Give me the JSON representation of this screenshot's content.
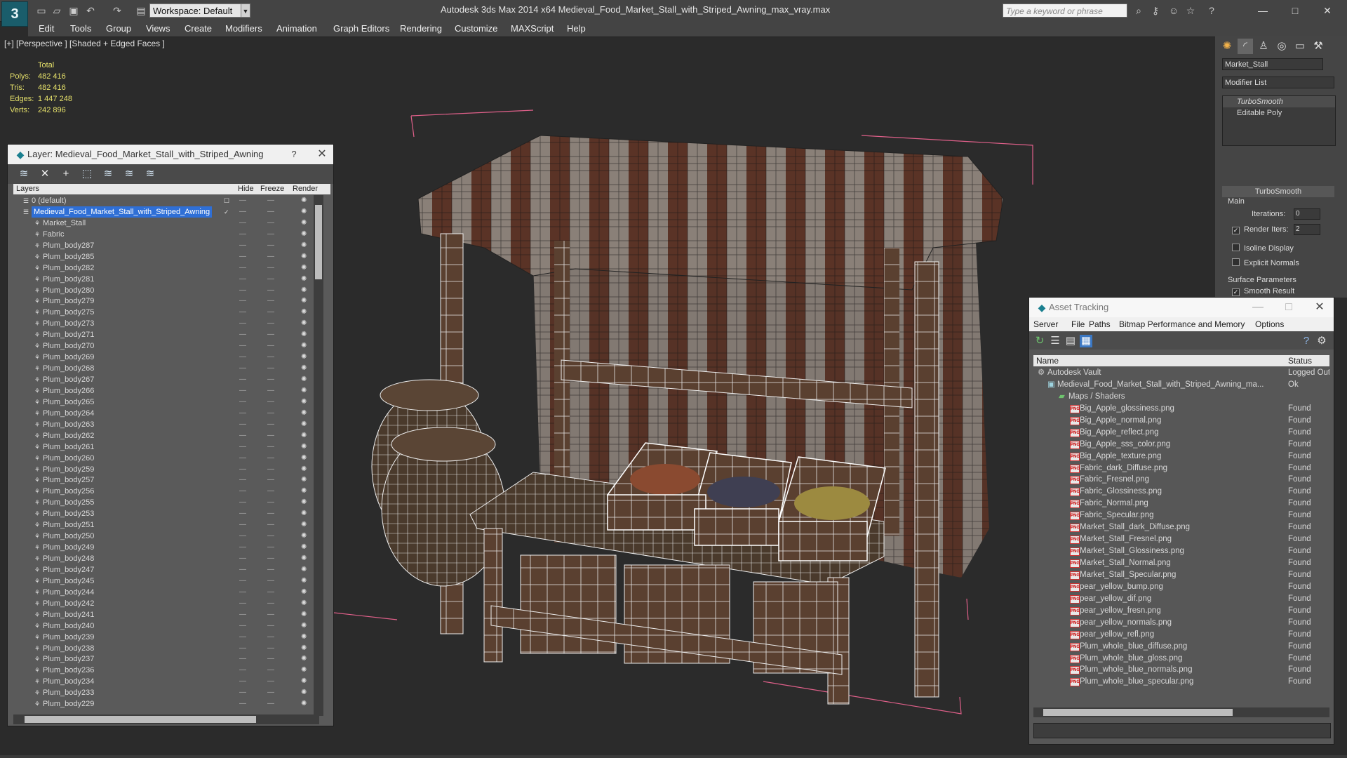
{
  "app": {
    "logo": "3",
    "workspace": "Workspace: Default",
    "title": "Autodesk 3ds Max  2014 x64       Medieval_Food_Market_Stall_with_Striped_Awning_max_vray.max",
    "search_placeholder": "Type a keyword or phrase"
  },
  "menu": [
    "Edit",
    "Tools",
    "Group",
    "Views",
    "Create",
    "Modifiers",
    "Animation",
    "Graph Editors",
    "Rendering",
    "Customize",
    "MAXScript",
    "Help"
  ],
  "viewport": {
    "label": "[+] [Perspective ] [Shaded + Edged Faces ]",
    "stats": {
      "header": "Total",
      "rows": [
        {
          "label": "Polys:",
          "value": "482 416"
        },
        {
          "label": "Tris:",
          "value": "482 416"
        },
        {
          "label": "Edges:",
          "value": "1 447 248"
        },
        {
          "label": "Verts:",
          "value": "242 896"
        }
      ]
    }
  },
  "layers": {
    "title": "Layer: Medieval_Food_Market_Stall_with_Striped_Awning",
    "help": "?",
    "columns": {
      "layers": "Layers",
      "hide": "Hide",
      "freeze": "Freeze",
      "render": "Render"
    },
    "rows": [
      {
        "name": "0 (default)",
        "level": 1
      },
      {
        "name": "Medieval_Food_Market_Stall_with_Striped_Awning",
        "level": 1,
        "selected": true
      },
      {
        "name": "Market_Stall",
        "level": 2
      },
      {
        "name": "Fabric",
        "level": 2
      },
      {
        "name": "Plum_body287",
        "level": 2
      },
      {
        "name": "Plum_body285",
        "level": 2
      },
      {
        "name": "Plum_body282",
        "level": 2
      },
      {
        "name": "Plum_body281",
        "level": 2
      },
      {
        "name": "Plum_body280",
        "level": 2
      },
      {
        "name": "Plum_body279",
        "level": 2
      },
      {
        "name": "Plum_body275",
        "level": 2
      },
      {
        "name": "Plum_body273",
        "level": 2
      },
      {
        "name": "Plum_body271",
        "level": 2
      },
      {
        "name": "Plum_body270",
        "level": 2
      },
      {
        "name": "Plum_body269",
        "level": 2
      },
      {
        "name": "Plum_body268",
        "level": 2
      },
      {
        "name": "Plum_body267",
        "level": 2
      },
      {
        "name": "Plum_body266",
        "level": 2
      },
      {
        "name": "Plum_body265",
        "level": 2
      },
      {
        "name": "Plum_body264",
        "level": 2
      },
      {
        "name": "Plum_body263",
        "level": 2
      },
      {
        "name": "Plum_body262",
        "level": 2
      },
      {
        "name": "Plum_body261",
        "level": 2
      },
      {
        "name": "Plum_body260",
        "level": 2
      },
      {
        "name": "Plum_body259",
        "level": 2
      },
      {
        "name": "Plum_body257",
        "level": 2
      },
      {
        "name": "Plum_body256",
        "level": 2
      },
      {
        "name": "Plum_body255",
        "level": 2
      },
      {
        "name": "Plum_body253",
        "level": 2
      },
      {
        "name": "Plum_body251",
        "level": 2
      },
      {
        "name": "Plum_body250",
        "level": 2
      },
      {
        "name": "Plum_body249",
        "level": 2
      },
      {
        "name": "Plum_body248",
        "level": 2
      },
      {
        "name": "Plum_body247",
        "level": 2
      },
      {
        "name": "Plum_body245",
        "level": 2
      },
      {
        "name": "Plum_body244",
        "level": 2
      },
      {
        "name": "Plum_body242",
        "level": 2
      },
      {
        "name": "Plum_body241",
        "level": 2
      },
      {
        "name": "Plum_body240",
        "level": 2
      },
      {
        "name": "Plum_body239",
        "level": 2
      },
      {
        "name": "Plum_body238",
        "level": 2
      },
      {
        "name": "Plum_body237",
        "level": 2
      },
      {
        "name": "Plum_body236",
        "level": 2
      },
      {
        "name": "Plum_body234",
        "level": 2
      },
      {
        "name": "Plum_body233",
        "level": 2
      },
      {
        "name": "Plum_body229",
        "level": 2
      }
    ]
  },
  "command_panel": {
    "object_name": "Market_Stall",
    "modifier_list": "Modifier List",
    "stack": [
      "TurboSmooth",
      "Editable Poly"
    ],
    "rollout": "TurboSmooth",
    "main_label": "Main",
    "iterations_label": "Iterations:",
    "iterations_value": "0",
    "render_iters_label": "Render Iters:",
    "render_iters_value": "2",
    "isoline": "Isoline Display",
    "explicit_normals": "Explicit Normals",
    "surface_params": "Surface Parameters",
    "smooth_result": "Smooth Result"
  },
  "asset_tracking": {
    "title": "Asset Tracking",
    "menu": [
      "Server",
      "File",
      "Paths",
      "Bitmap Performance and Memory",
      "Options"
    ],
    "columns": {
      "name": "Name",
      "status": "Status"
    },
    "rows": [
      {
        "name": "Autodesk Vault",
        "status": "Logged Out",
        "level": 0,
        "kind": "vault"
      },
      {
        "name": "Medieval_Food_Market_Stall_with_Striped_Awning_ma...",
        "status": "Ok",
        "level": 1,
        "kind": "max"
      },
      {
        "name": "Maps / Shaders",
        "status": "",
        "level": 2,
        "kind": "folder"
      },
      {
        "name": "Big_Apple_glossiness.png",
        "status": "Found",
        "level": 3,
        "kind": "png"
      },
      {
        "name": "Big_Apple_normal.png",
        "status": "Found",
        "level": 3,
        "kind": "png"
      },
      {
        "name": "Big_Apple_reflect.png",
        "status": "Found",
        "level": 3,
        "kind": "png"
      },
      {
        "name": "Big_Apple_sss_color.png",
        "status": "Found",
        "level": 3,
        "kind": "png"
      },
      {
        "name": "Big_Apple_texture.png",
        "status": "Found",
        "level": 3,
        "kind": "png"
      },
      {
        "name": "Fabric_dark_Diffuse.png",
        "status": "Found",
        "level": 3,
        "kind": "png"
      },
      {
        "name": "Fabric_Fresnel.png",
        "status": "Found",
        "level": 3,
        "kind": "png"
      },
      {
        "name": "Fabric_Glossiness.png",
        "status": "Found",
        "level": 3,
        "kind": "png"
      },
      {
        "name": "Fabric_Normal.png",
        "status": "Found",
        "level": 3,
        "kind": "png"
      },
      {
        "name": "Fabric_Specular.png",
        "status": "Found",
        "level": 3,
        "kind": "png"
      },
      {
        "name": "Market_Stall_dark_Diffuse.png",
        "status": "Found",
        "level": 3,
        "kind": "png"
      },
      {
        "name": "Market_Stall_Fresnel.png",
        "status": "Found",
        "level": 3,
        "kind": "png"
      },
      {
        "name": "Market_Stall_Glossiness.png",
        "status": "Found",
        "level": 3,
        "kind": "png"
      },
      {
        "name": "Market_Stall_Normal.png",
        "status": "Found",
        "level": 3,
        "kind": "png"
      },
      {
        "name": "Market_Stall_Specular.png",
        "status": "Found",
        "level": 3,
        "kind": "png"
      },
      {
        "name": "pear_yellow_bump.png",
        "status": "Found",
        "level": 3,
        "kind": "png"
      },
      {
        "name": "pear_yellow_dif.png",
        "status": "Found",
        "level": 3,
        "kind": "png"
      },
      {
        "name": "pear_yellow_fresn.png",
        "status": "Found",
        "level": 3,
        "kind": "png"
      },
      {
        "name": "pear_yellow_normals.png",
        "status": "Found",
        "level": 3,
        "kind": "png"
      },
      {
        "name": "pear_yellow_refl.png",
        "status": "Found",
        "level": 3,
        "kind": "png"
      },
      {
        "name": "Plum_whole_blue_diffuse.png",
        "status": "Found",
        "level": 3,
        "kind": "png"
      },
      {
        "name": "Plum_whole_blue_gloss.png",
        "status": "Found",
        "level": 3,
        "kind": "png"
      },
      {
        "name": "Plum_whole_blue_normals.png",
        "status": "Found",
        "level": 3,
        "kind": "png"
      },
      {
        "name": "Plum_whole_blue_specular.png",
        "status": "Found",
        "level": 3,
        "kind": "png"
      }
    ]
  },
  "colors": {
    "stats_yellow": "#e5e06a",
    "selection_blue": "#2f6fd6",
    "bbox_pink": "#e0608a"
  }
}
